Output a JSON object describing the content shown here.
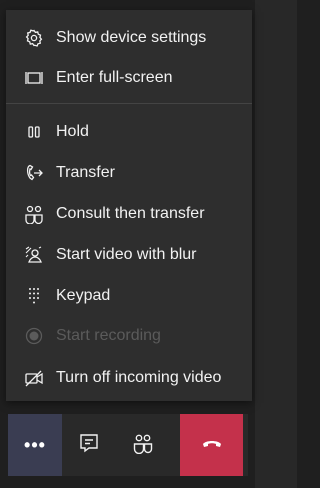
{
  "menu": {
    "items": [
      {
        "label": "Show device settings",
        "icon": "gear-icon"
      },
      {
        "label": "Enter full-screen",
        "icon": "fullscreen-icon"
      },
      {
        "label": "Hold",
        "icon": "pause-icon"
      },
      {
        "label": "Transfer",
        "icon": "transfer-icon"
      },
      {
        "label": "Consult then transfer",
        "icon": "consult-transfer-icon"
      },
      {
        "label": "Start video with blur",
        "icon": "blur-video-icon"
      },
      {
        "label": "Keypad",
        "icon": "keypad-icon"
      },
      {
        "label": "Start recording",
        "icon": "record-icon",
        "disabled": true
      },
      {
        "label": "Turn off incoming video",
        "icon": "video-off-icon"
      }
    ]
  },
  "toolbar": {
    "more_label": "•••",
    "buttons": [
      "more-icon",
      "chat-icon",
      "participants-icon",
      "hang-up-icon"
    ],
    "colors": {
      "more_bg": "#3a3d52",
      "end_call_bg": "#c4314b"
    }
  }
}
